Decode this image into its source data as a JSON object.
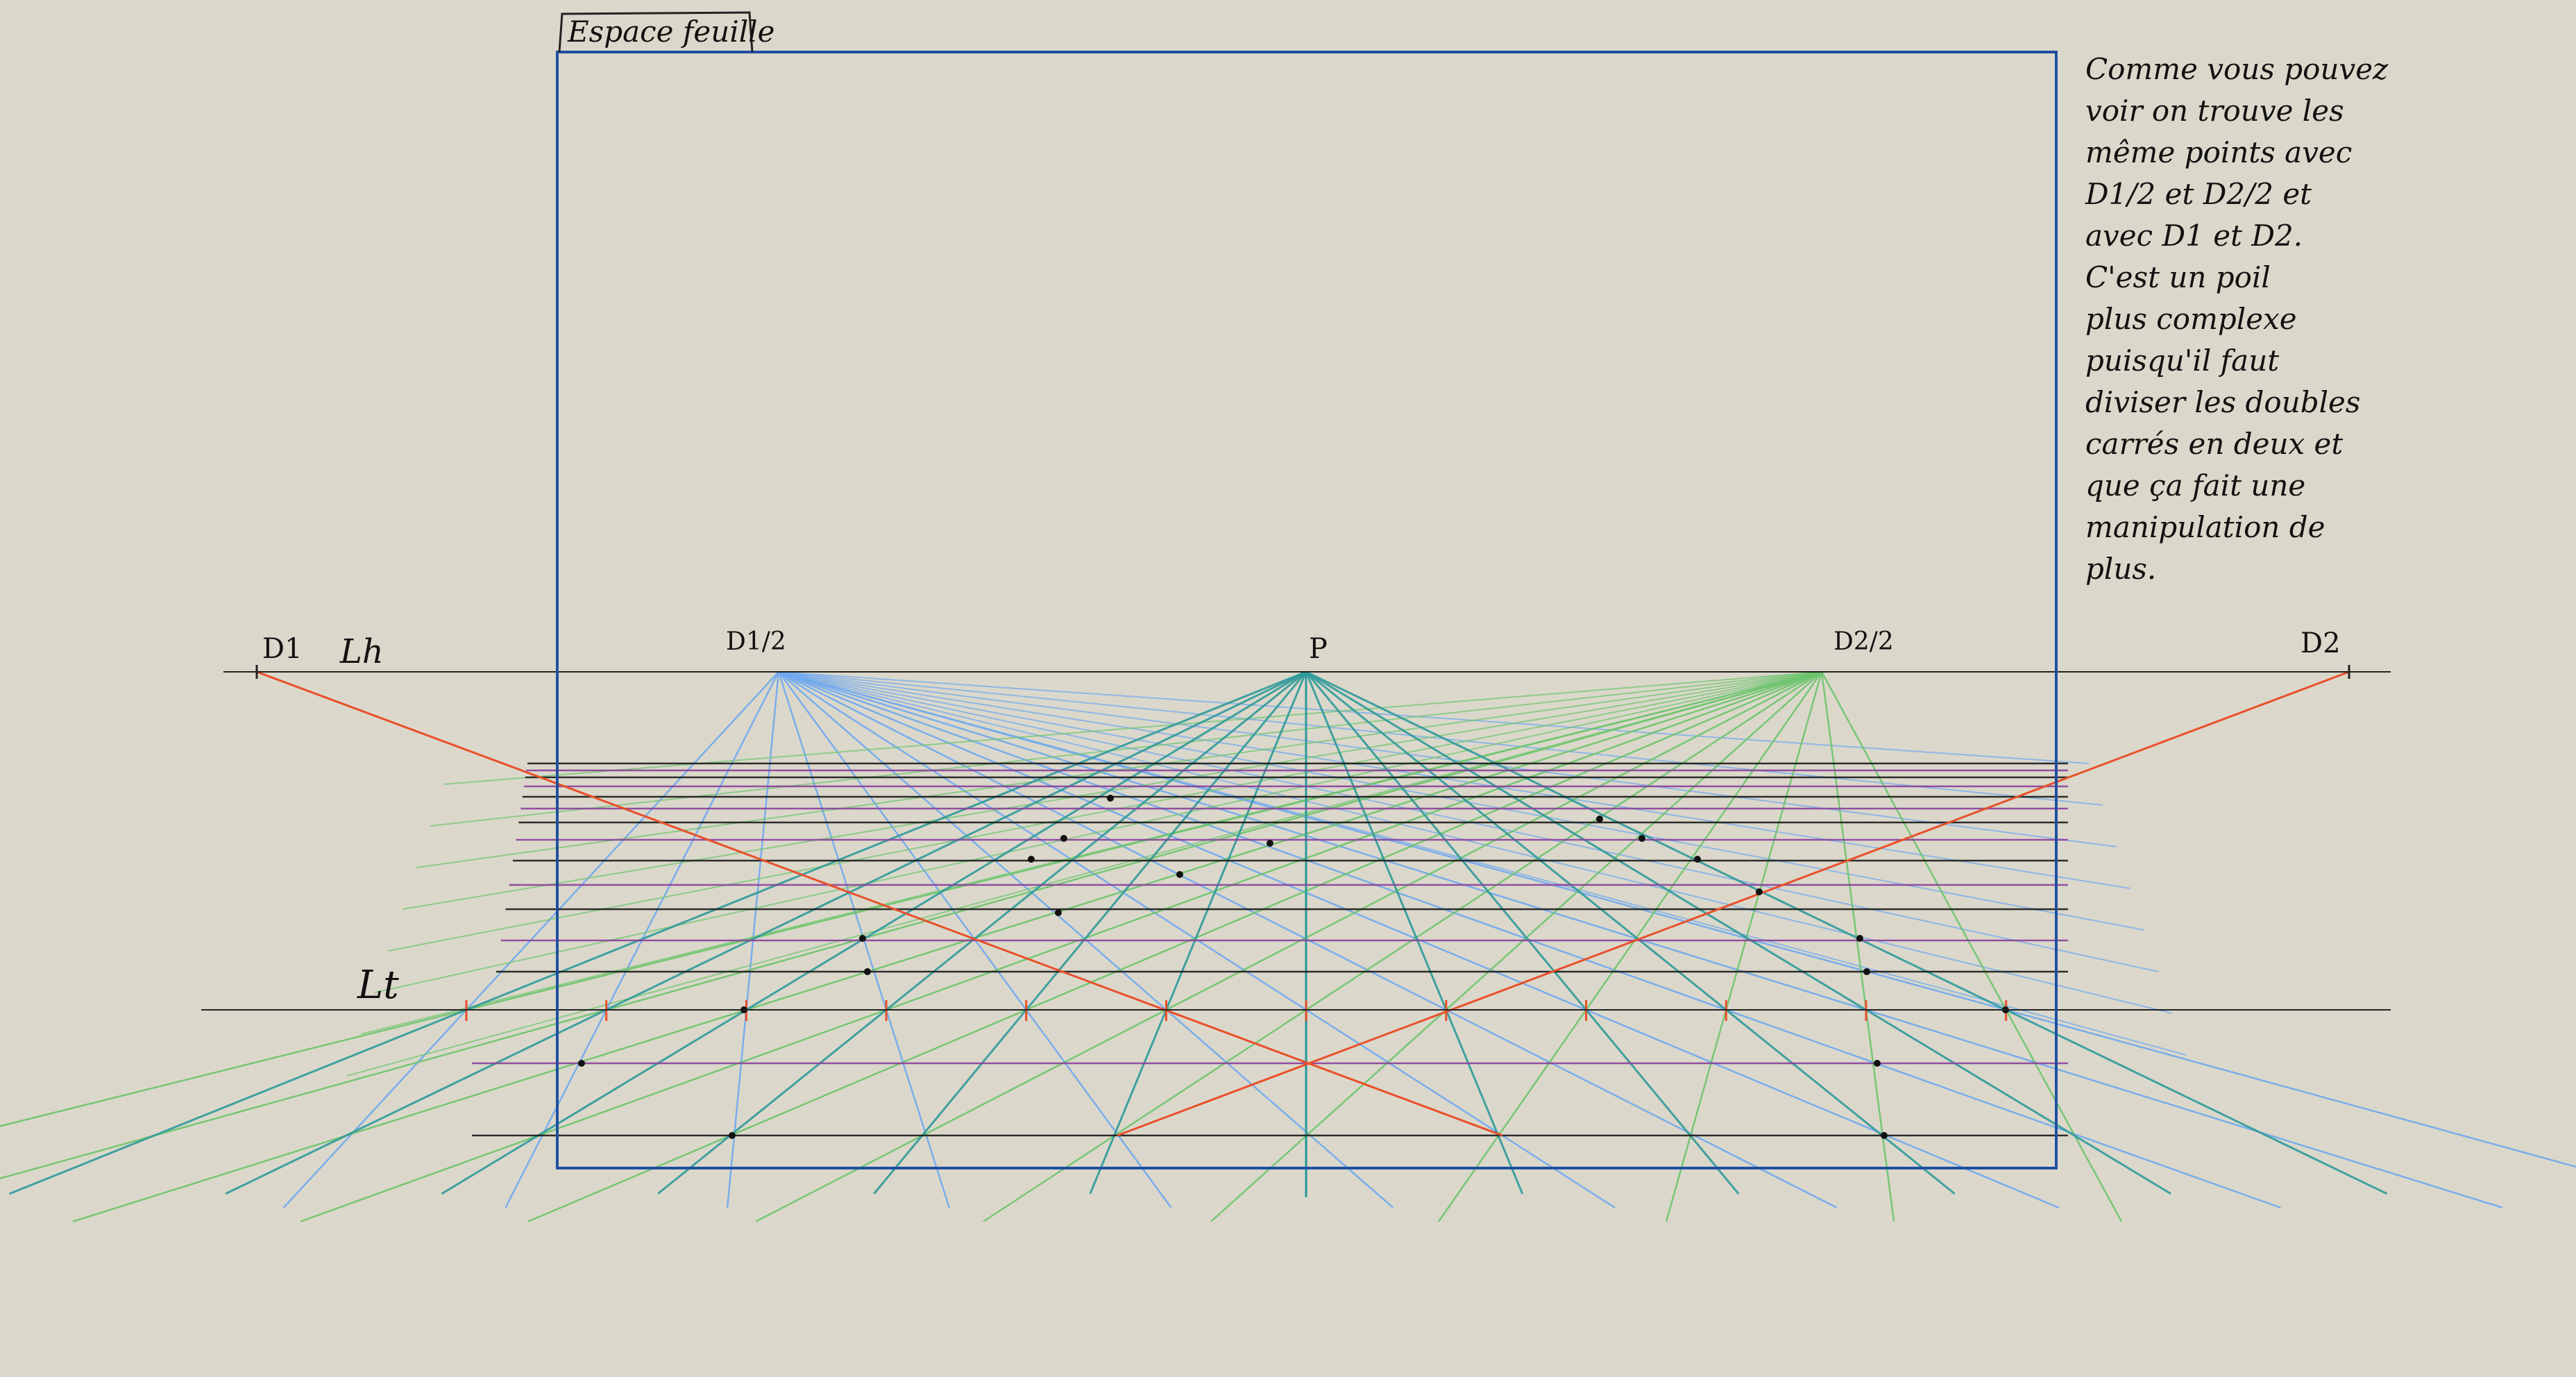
{
  "diagram": {
    "sheet_label": "Espace feuille",
    "horizon_label": "Lh",
    "ground_label": "Lt",
    "point_D1": "D1",
    "point_D1_half": "D1/2",
    "point_P": "P",
    "point_D2_half": "D2/2",
    "point_D2": "D2",
    "note_lines": [
      "Comme vous pouvez",
      "voir on trouve les",
      "même points avec",
      "D1/2 et D2/2 et",
      "avec D1 et D2.",
      "C'est un poil",
      "plus complexe",
      "puisqu'il faut",
      "diviser les doubles",
      "carrés en deux et",
      "que ça fait une",
      "manipulation de",
      "plus."
    ]
  },
  "colors": {
    "background": "#dbd8cb",
    "sheet_frame": "#1f4fa0",
    "horizon": "#222222",
    "diagonal": "#e8502a",
    "d1_half_rays": "#6fa8ee",
    "p_rays": "#2f9a9a",
    "d2_half_rays": "#6cc46c",
    "transversal_purple": "#8a3f9a",
    "transversal_black": "#1a1a1a"
  }
}
